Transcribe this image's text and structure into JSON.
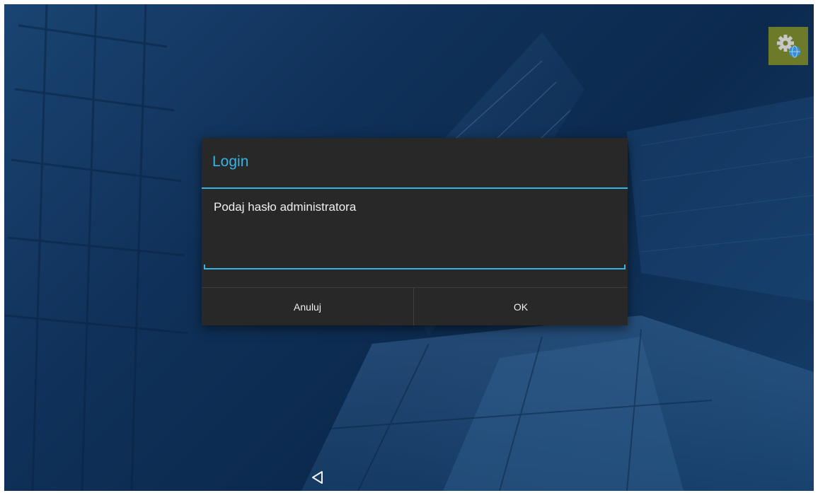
{
  "dialog": {
    "title": "Login",
    "message": "Podaj hasło administratora",
    "password_value": "",
    "cancel_label": "Anuluj",
    "ok_label": "OK"
  },
  "icons": {
    "settings": "gear-globe-icon",
    "back": "back-triangle-icon"
  },
  "colors": {
    "accent": "#33b5e5",
    "dialog_background": "#282828",
    "settings_tile": "#6d7a2a"
  }
}
